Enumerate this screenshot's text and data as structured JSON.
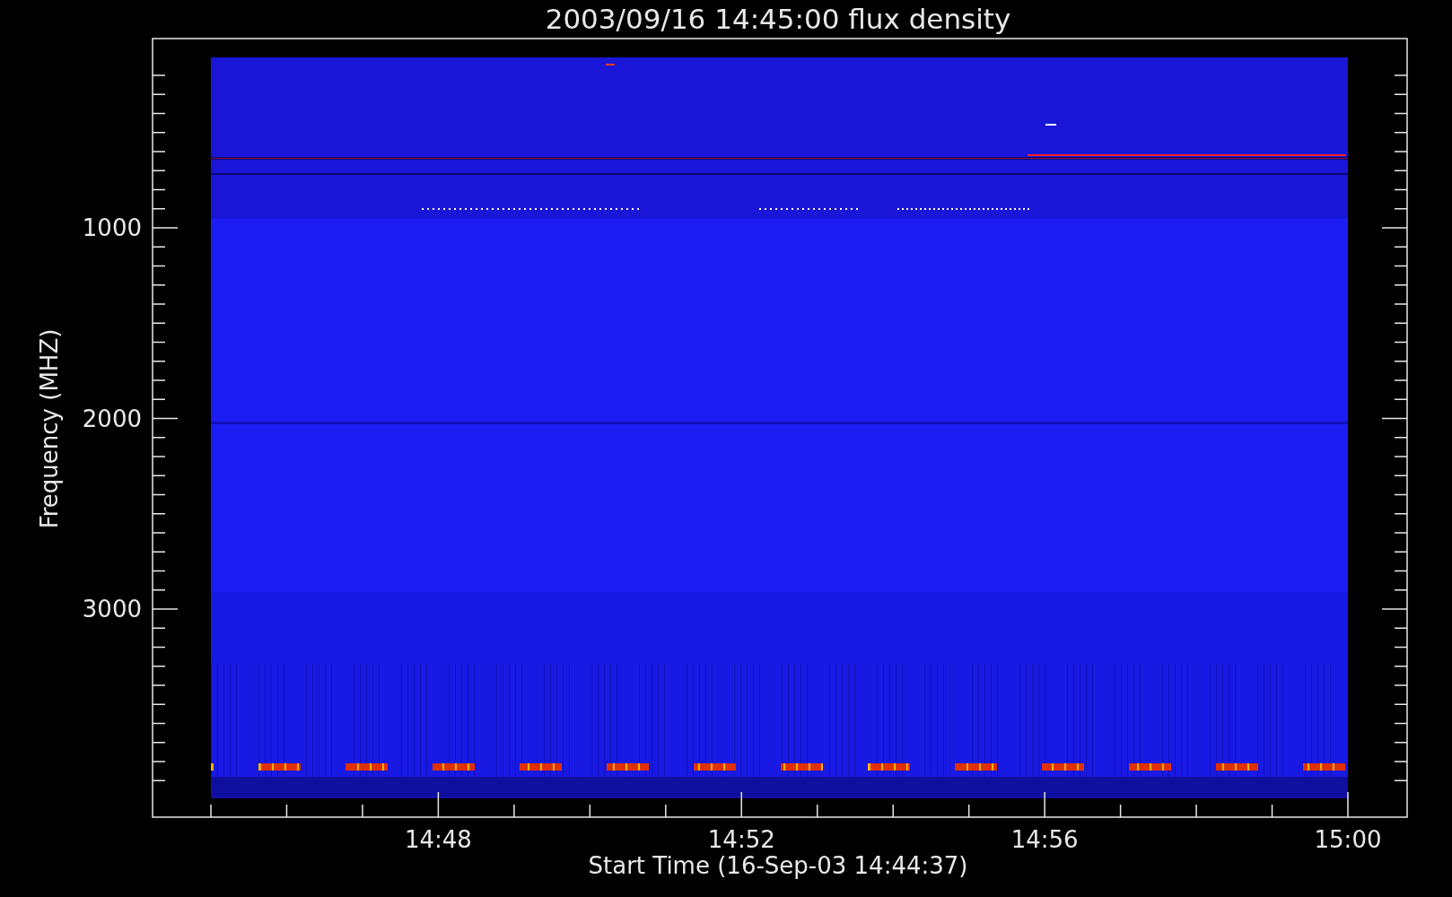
{
  "chart": {
    "title": "2003/09/16 14:45:00 flux density",
    "xlabel": "Start Time (16-Sep-03 14:44:37)",
    "ylabel": "Frequency (MHZ)",
    "xticks": [
      "14:48",
      "14:52",
      "14:56",
      "15:00"
    ],
    "yticks": [
      "1000",
      "2000",
      "3000"
    ]
  }
}
